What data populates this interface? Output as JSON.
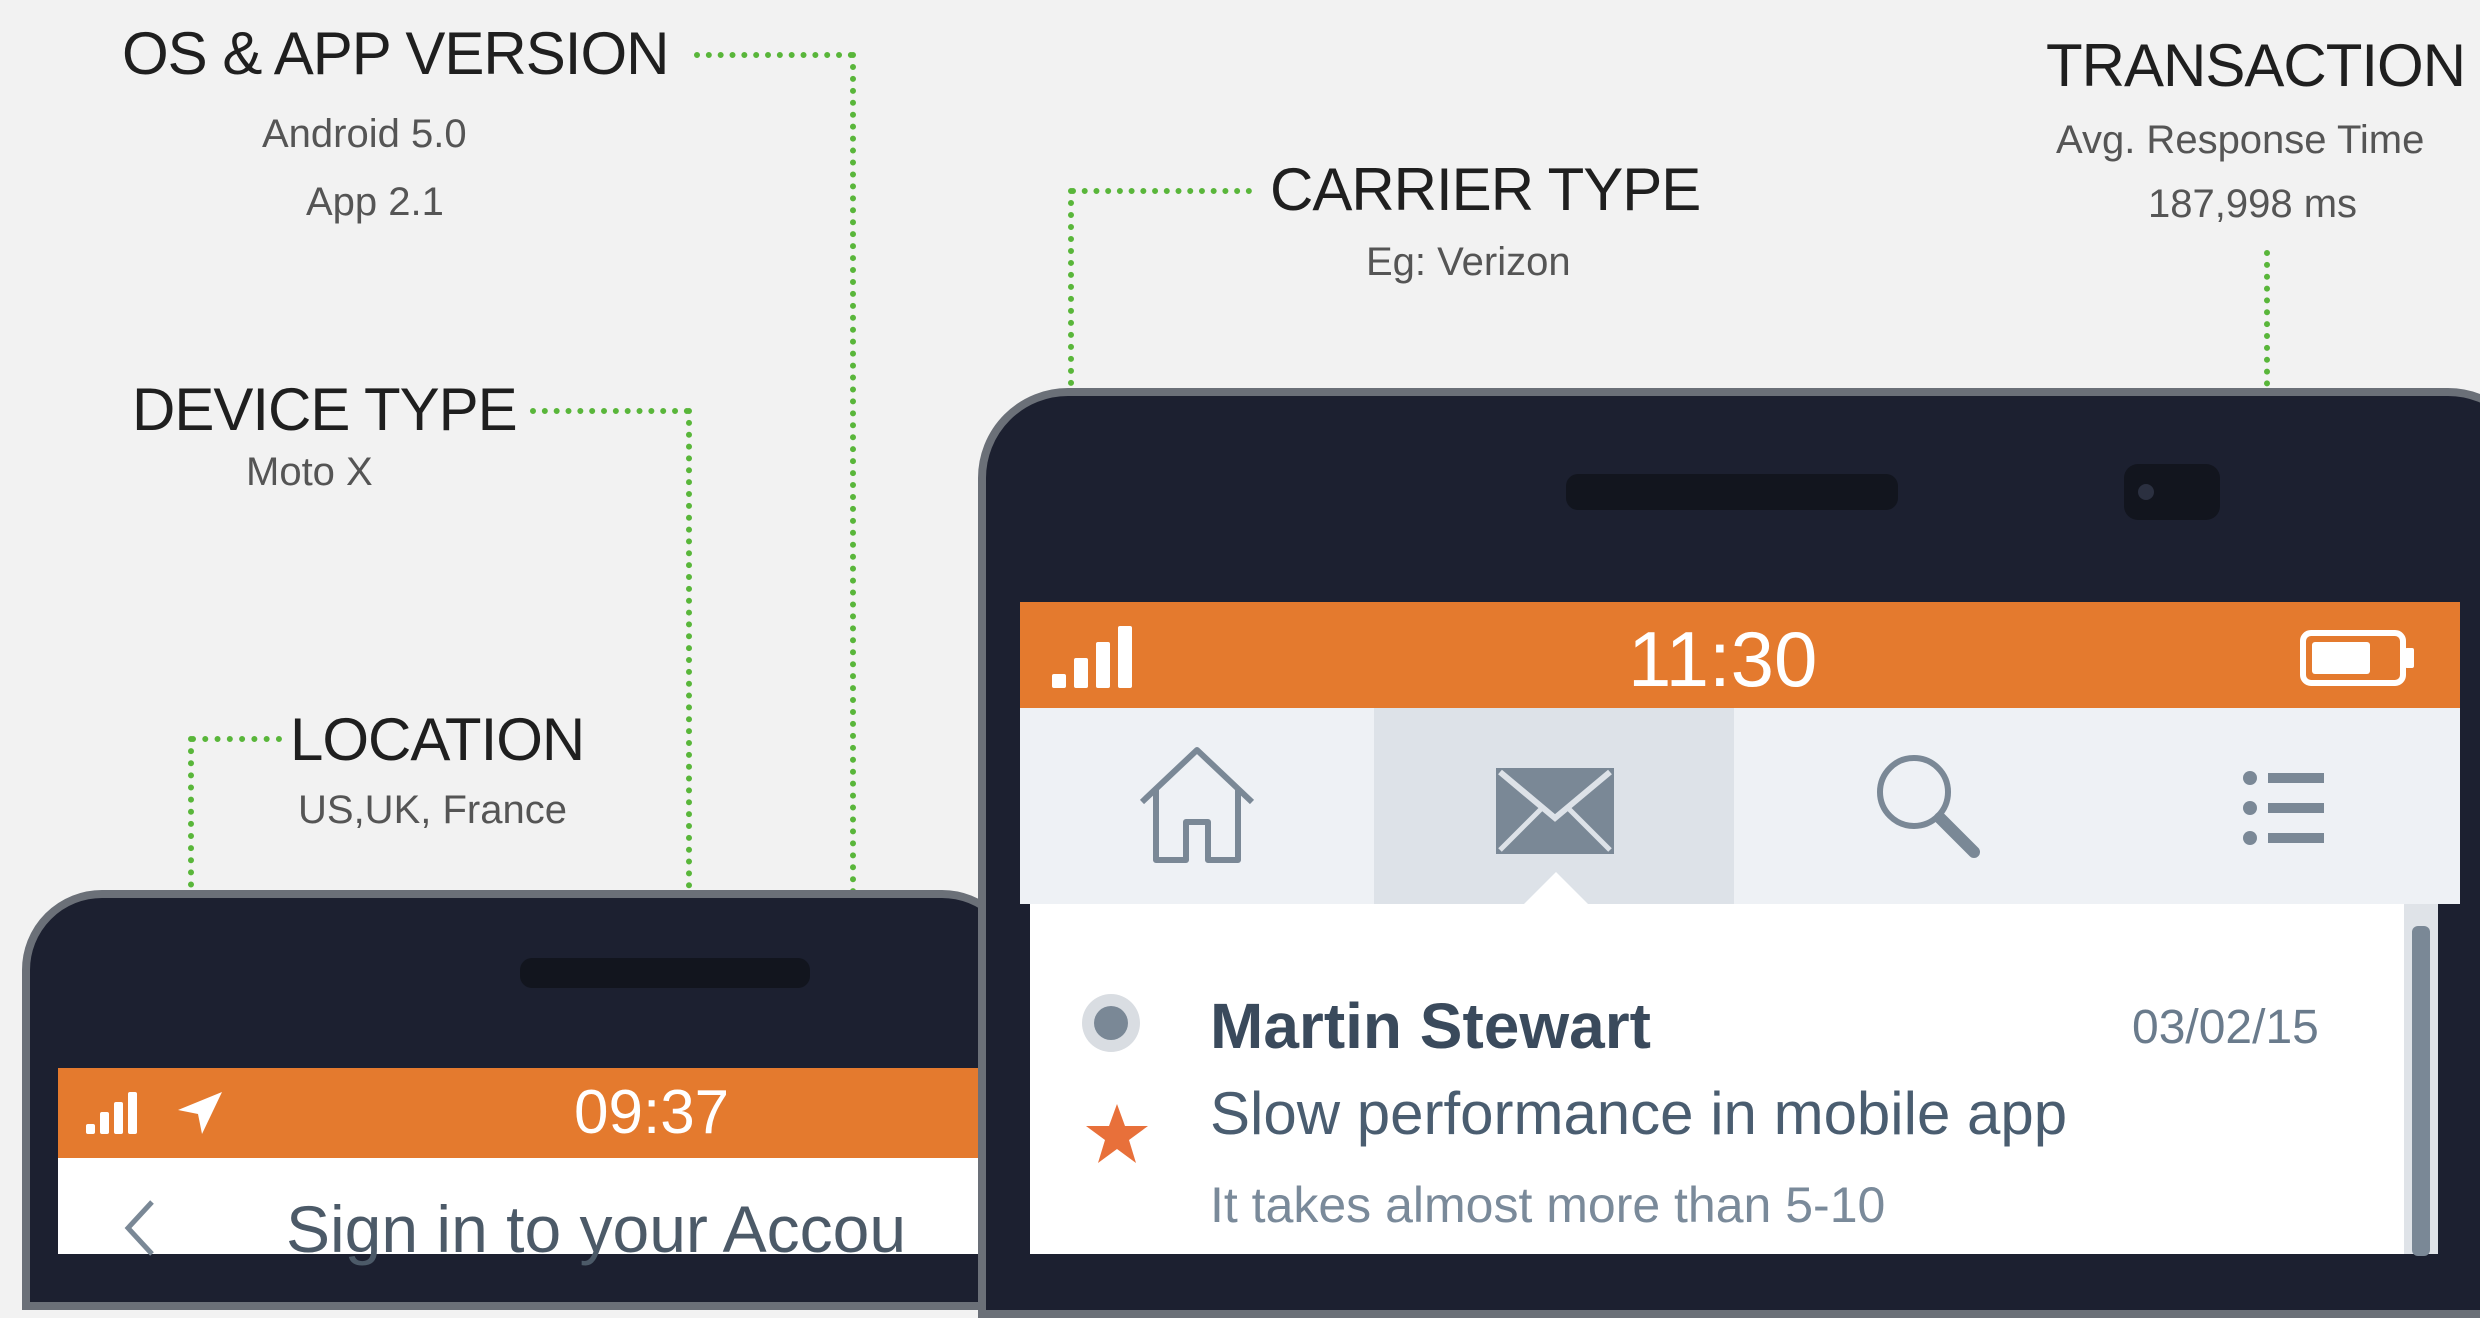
{
  "annotations": {
    "os_app": {
      "title": "OS & APP VERSION",
      "line1": "Android 5.0",
      "line2": "App 2.1"
    },
    "device": {
      "title": "DEVICE TYPE",
      "sub": "Moto X"
    },
    "location": {
      "title": "LOCATION",
      "sub": "US,UK, France"
    },
    "carrier": {
      "title": "CARRIER TYPE",
      "sub": "Eg: Verizon"
    },
    "transaction": {
      "title": "TRANSACTION",
      "line1": "Avg. Response Time",
      "line2": "187,998 ms"
    }
  },
  "left_phone": {
    "time": "09:37",
    "screen_title": "Sign in to your Accou",
    "icons": [
      "signal-icon",
      "location-arrow-icon",
      "back-chevron-icon"
    ]
  },
  "right_phone": {
    "time": "11:30",
    "tabs": [
      "home-icon",
      "mail-icon",
      "search-icon",
      "list-icon"
    ],
    "active_tab": "mail-icon",
    "message": {
      "sender": "Martin Stewart",
      "date": "03/02/15",
      "subject": "Slow performance in mobile app",
      "preview": "It takes almost more than 5-10"
    }
  },
  "colors": {
    "accent": "#e47a2e",
    "annotation_line": "#59b63a",
    "phone_body": "#1c2030",
    "background": "#f2f2f2"
  }
}
